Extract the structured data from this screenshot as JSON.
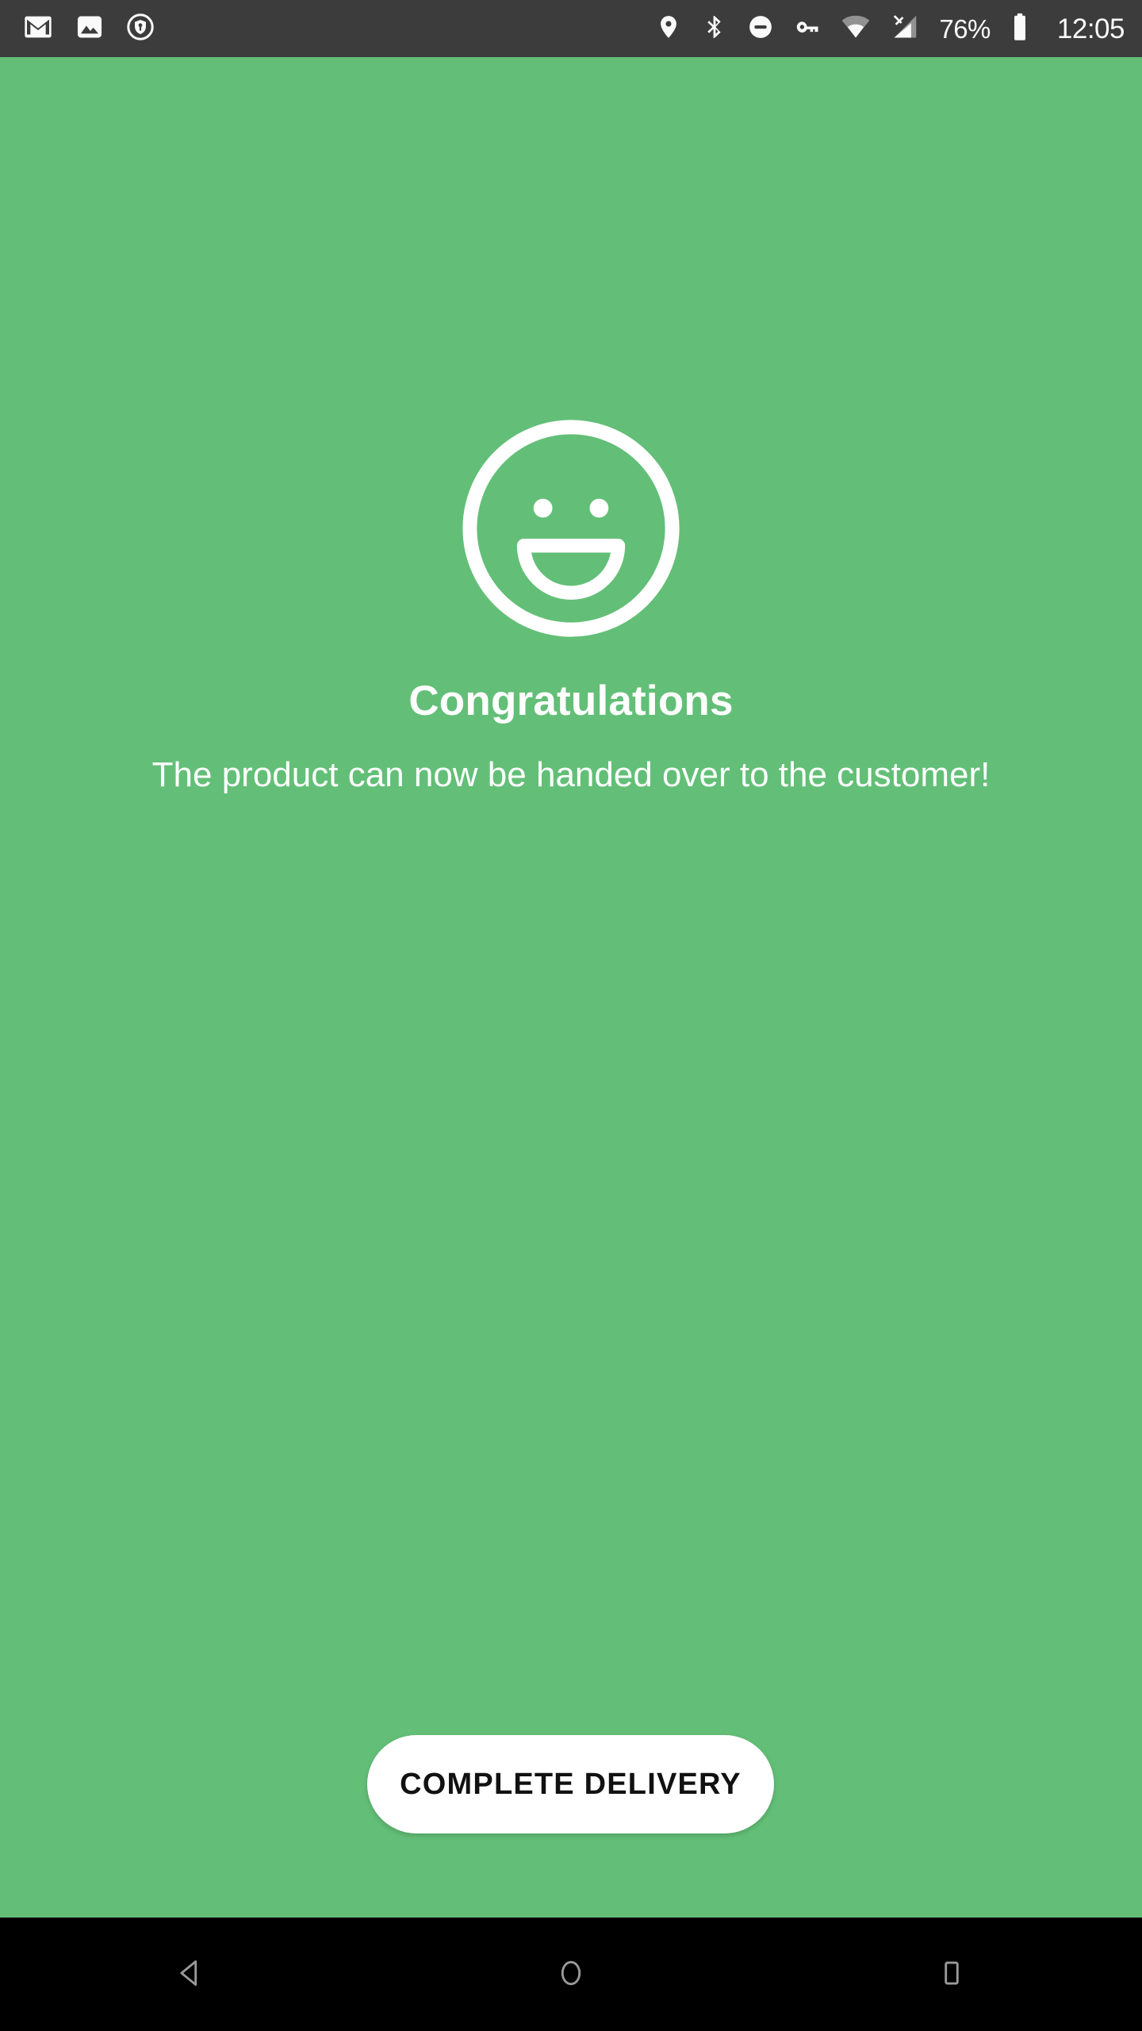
{
  "status_bar": {
    "background_color": "#3c3c3c",
    "foreground_color": "#fafafa",
    "notifications": [
      {
        "name": "gmail-icon",
        "label": "Gmail"
      },
      {
        "name": "photos-icon",
        "label": "Photos"
      },
      {
        "name": "password-shield-icon",
        "label": "Password manager"
      }
    ],
    "system_icons": [
      {
        "name": "location-icon",
        "label": "Location"
      },
      {
        "name": "bluetooth-icon",
        "label": "Bluetooth"
      },
      {
        "name": "do-not-disturb-icon",
        "label": "Do not disturb"
      },
      {
        "name": "vpn-key-icon",
        "label": "VPN"
      },
      {
        "name": "wifi-icon",
        "label": "Wi-Fi"
      },
      {
        "name": "cellular-no-sim-icon",
        "label": "No SIM"
      }
    ],
    "battery_percent": "76%",
    "clock": "12:05"
  },
  "screen": {
    "background_color": "#63bf77",
    "icon": {
      "name": "smiley-face-icon",
      "label": "Smiling face",
      "color": "#ffffff"
    },
    "headline": "Congratulations",
    "subtitle": "The product can now be handed over to the customer!"
  },
  "primary_button": {
    "label": "COMPLETE DELIVERY",
    "background_color": "#ffffff",
    "text_color": "#111111"
  },
  "nav_bar": {
    "background_color": "#000000",
    "buttons": [
      {
        "name": "nav-back-button",
        "label": "Back"
      },
      {
        "name": "nav-home-button",
        "label": "Home"
      },
      {
        "name": "nav-recents-button",
        "label": "Recents"
      }
    ]
  }
}
